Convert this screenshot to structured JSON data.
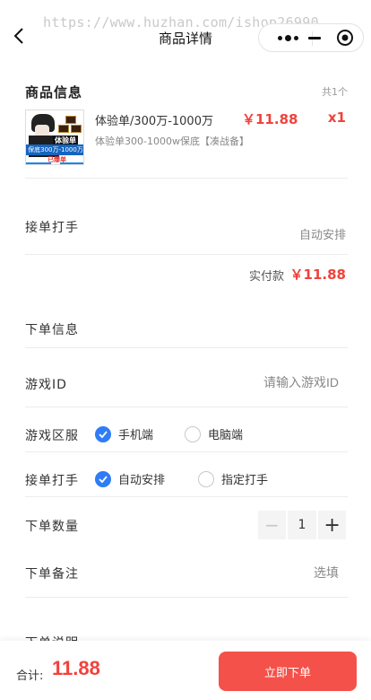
{
  "header": {
    "watermark": "https://www.huzhan.com/ishop26990",
    "title": "商品详情"
  },
  "product_section": {
    "heading": "商品信息",
    "count": "共1个",
    "thumb": {
      "name_tag": "体验单",
      "band_text": "保底300万-1000万",
      "red_text": "已爆单"
    },
    "name": "体验单/300万-1000万",
    "price": "￥11.88",
    "qty": "x1",
    "desc": "体验单300-1000w保底【凑战备】"
  },
  "assign": {
    "label": "接单打手",
    "value": "自动安排"
  },
  "paid": {
    "label": "实付款",
    "value": "￥11.88"
  },
  "order_info": {
    "heading": "下单信息",
    "game_id": {
      "label": "游戏ID",
      "placeholder": "请输入游戏ID"
    },
    "server": {
      "label": "游戏区服",
      "options": [
        "手机端",
        "电脑端"
      ],
      "selected": "手机端"
    },
    "player": {
      "label": "接单打手",
      "options": [
        "自动安排",
        "指定打手"
      ],
      "selected": "自动安排"
    },
    "quantity": {
      "label": "下单数量",
      "value": "1",
      "minus": "−",
      "plus": "+"
    },
    "remark": {
      "label": "下单备注",
      "placeholder": "选填"
    },
    "notes_label": "下单说明"
  },
  "footer": {
    "total_label": "合计:",
    "total_value": "11.88",
    "submit_label": "立即下单"
  },
  "colors": {
    "accent_red": "#f0423b",
    "radio_blue": "#2f7cf6",
    "submit_bg": "#f4514a"
  }
}
